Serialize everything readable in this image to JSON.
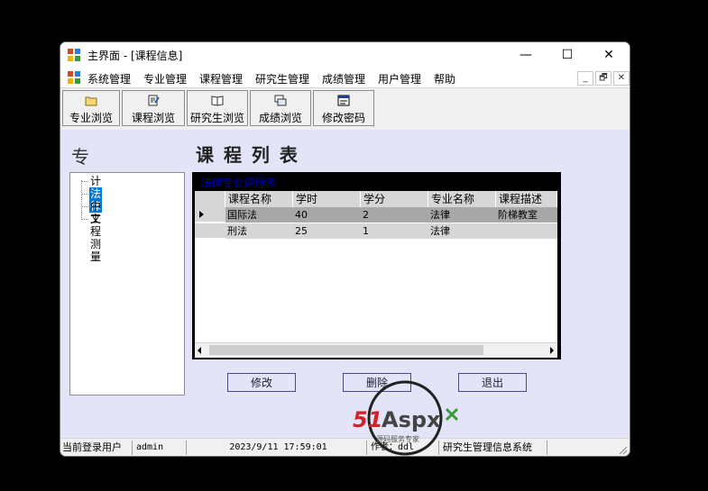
{
  "window": {
    "title": "主界面 - [课程信息]"
  },
  "window_controls": {
    "minimize": "—",
    "maximize": "☐",
    "close": "✕"
  },
  "menu": {
    "items": [
      "系统管理",
      "专业管理",
      "课程管理",
      "研究生管理",
      "成绩管理",
      "用户管理",
      "帮助"
    ],
    "mdi_buttons": [
      "_",
      "🗗",
      "✕"
    ]
  },
  "toolbar": {
    "buttons": [
      "专业浏览",
      "课程浏览",
      "研究生浏览",
      "成绩浏览",
      "修改密码"
    ]
  },
  "main": {
    "side_label": "专",
    "heading": "课 程 列 表",
    "tree": [
      "计算机",
      "法律",
      "中文",
      "工程测量"
    ],
    "tree_selected": "法律",
    "grid": {
      "caption": "法律专业课程表",
      "columns": [
        "课程名称",
        "学时",
        "学分",
        "专业名称",
        "课程描述"
      ],
      "rows": [
        [
          "国际法",
          "40",
          "2",
          "法律",
          "阶梯教室"
        ],
        [
          "刑法",
          "25",
          "1",
          "法律",
          ""
        ]
      ]
    },
    "buttons": {
      "edit": "修改",
      "delete": "删除",
      "exit": "退出"
    }
  },
  "status": {
    "user_label": "当前登录用户",
    "user": "admin",
    "datetime": "2023/9/11 17:59:01",
    "author": "作者：ddl",
    "system": "研究生管理信息系统"
  },
  "watermark": {
    "brand": "51Aspx",
    "tagline": "源码服务专家"
  },
  "colors": {
    "client_bg": "#e4e4f8",
    "selection": "#0078d7",
    "brand_red": "#d2232a",
    "brand_green": "#3a9a3a"
  }
}
